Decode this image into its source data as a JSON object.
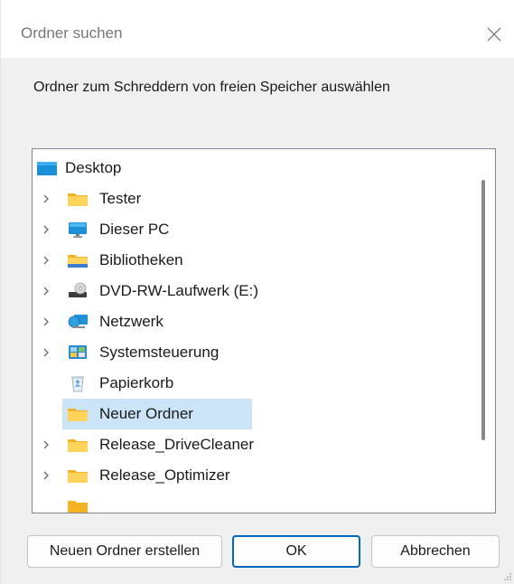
{
  "dialog": {
    "title": "Ordner suchen",
    "instruction": "Ordner zum Schreddern von freien Speicher auswählen"
  },
  "tree": {
    "items": [
      {
        "label": "Desktop",
        "icon": "desktop-icon",
        "expandable": false,
        "selected": false
      },
      {
        "label": "Tester",
        "icon": "folder-icon",
        "expandable": true,
        "selected": false
      },
      {
        "label": "Dieser PC",
        "icon": "computer-icon",
        "expandable": true,
        "selected": false
      },
      {
        "label": "Bibliotheken",
        "icon": "libraries-icon",
        "expandable": true,
        "selected": false
      },
      {
        "label": "DVD-RW-Laufwerk (E:)",
        "icon": "dvd-drive-icon",
        "expandable": true,
        "selected": false
      },
      {
        "label": "Netzwerk",
        "icon": "network-icon",
        "expandable": true,
        "selected": false
      },
      {
        "label": "Systemsteuerung",
        "icon": "control-panel-icon",
        "expandable": true,
        "selected": false
      },
      {
        "label": "Papierkorb",
        "icon": "recycle-bin-icon",
        "expandable": false,
        "selected": false
      },
      {
        "label": "Neuer Ordner",
        "icon": "folder-icon",
        "expandable": false,
        "selected": true
      },
      {
        "label": "Release_DriveCleaner",
        "icon": "folder-icon",
        "expandable": true,
        "selected": false
      },
      {
        "label": "Release_Optimizer",
        "icon": "folder-icon",
        "expandable": true,
        "selected": false
      }
    ]
  },
  "buttons": {
    "new_folder": "Neuen Ordner erstellen",
    "ok": "OK",
    "cancel": "Abbrechen"
  },
  "colors": {
    "selection": "#cce4f7",
    "folder": "#ffc83d",
    "accent": "#0067c0"
  }
}
